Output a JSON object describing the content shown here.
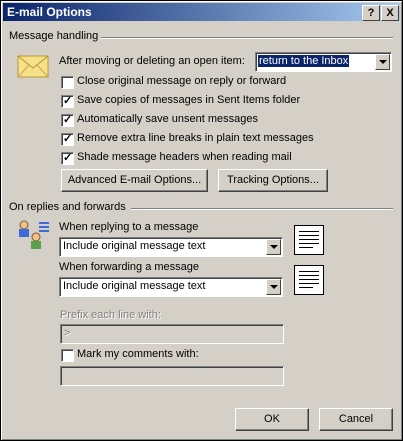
{
  "window": {
    "title": "E-mail Options",
    "help_button": "?",
    "close_button": "X"
  },
  "message_handling": {
    "title": "Message handling",
    "after_moving_label": "After moving or deleting an open item:",
    "after_moving_value": "return to the Inbox",
    "options": [
      {
        "label": "Close original message on reply or forward",
        "checked": false
      },
      {
        "label": "Save copies of messages in Sent Items folder",
        "checked": true
      },
      {
        "label": "Automatically save unsent messages",
        "checked": true
      },
      {
        "label": "Remove extra line breaks in plain text messages",
        "checked": true
      },
      {
        "label": "Shade message headers when reading mail",
        "checked": true
      }
    ],
    "advanced_button": "Advanced E-mail Options...",
    "tracking_button": "Tracking Options..."
  },
  "replies_forwards": {
    "title": "On replies and forwards",
    "replying_label": "When replying to a message",
    "replying_value": "Include original message text",
    "forwarding_label": "When forwarding a message",
    "forwarding_value": "Include original message text",
    "prefix_label": "Prefix each line with:",
    "prefix_value": ">",
    "mark_label": "Mark my comments with:",
    "mark_checked": false,
    "mark_value": ""
  },
  "footer": {
    "ok": "OK",
    "cancel": "Cancel"
  },
  "colors": {
    "dialog_bg": "#d4d0c8",
    "titlebar_start": "#0a246a",
    "titlebar_end": "#a6caf0",
    "selection": "#0a246a"
  }
}
